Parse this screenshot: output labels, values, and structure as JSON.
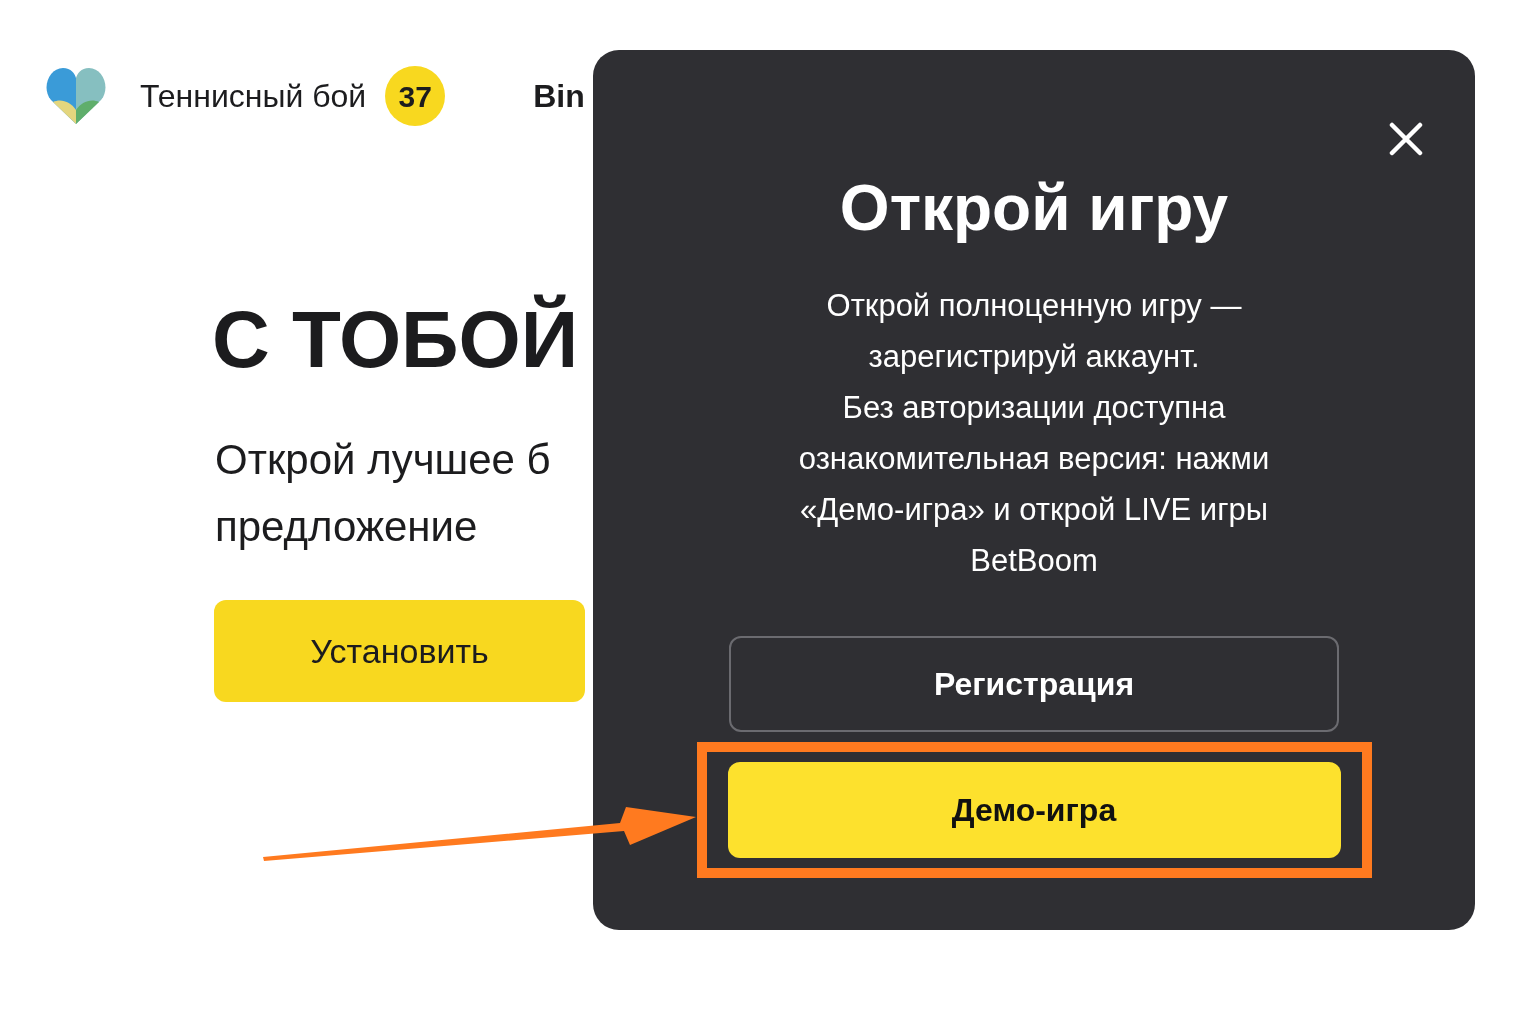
{
  "header": {
    "title": "Теннисный бой",
    "badge": "37",
    "next_item": "Bin"
  },
  "hero": {
    "headline": "С ТОБОЙ",
    "subtitle_lines": [
      "Открой лучшее б",
      "предложение"
    ],
    "install_button": "Установить"
  },
  "modal": {
    "title": "Открой игру",
    "body": "Открой полноценную игру —\nзарегистрируй аккаунт.\nБез авторизации доступна\nознакомительная версия: нажми\n«Демо-игра» и открой LIVE игры\nBetBoom",
    "buttons": [
      {
        "label": "Регистрация",
        "kind": "outline",
        "highlighted": false
      },
      {
        "label": "Демо-игра",
        "kind": "primary",
        "highlighted": true
      }
    ]
  }
}
